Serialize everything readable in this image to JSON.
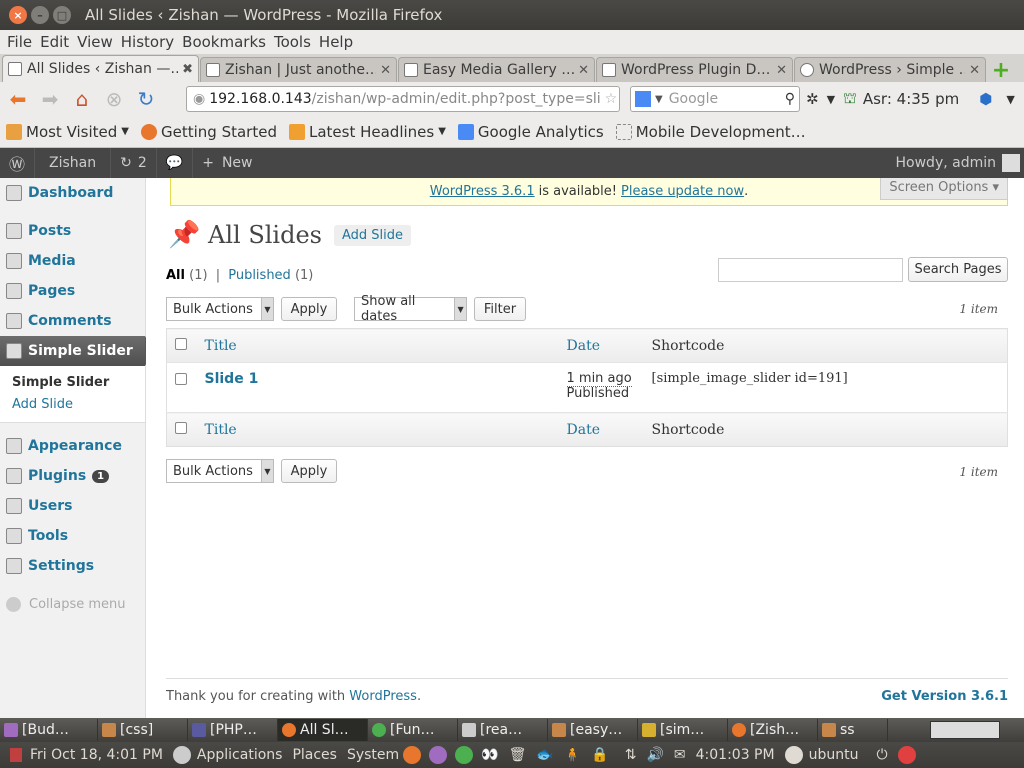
{
  "window": {
    "title": "All Slides ‹ Zishan — WordPress - Mozilla Firefox"
  },
  "menubar": [
    "File",
    "Edit",
    "View",
    "History",
    "Bookmarks",
    "Tools",
    "Help"
  ],
  "tabs": [
    {
      "label": "All Slides ‹ Zishan —…",
      "active": true
    },
    {
      "label": "Zishan | Just anothe…",
      "active": false
    },
    {
      "label": "Easy Media Gallery …",
      "active": false
    },
    {
      "label": "WordPress Plugin D…",
      "active": false
    },
    {
      "label": "WordPress › Simple …",
      "active": false
    }
  ],
  "nav": {
    "url_host": "192.168.0.143",
    "url_path": "/zishan/wp-admin/edit.php?post_type=sli",
    "search_placeholder": "Google",
    "extra": "Asr: 4:35 pm"
  },
  "bookmarks": [
    "Most Visited",
    "Getting Started",
    "Latest Headlines",
    "Google Analytics",
    "Mobile Development…"
  ],
  "adminbar": {
    "site": "Zishan",
    "updates": "2",
    "new": "New",
    "howdy": "Howdy, admin"
  },
  "sidebar": {
    "items": [
      {
        "label": "Dashboard"
      },
      {
        "label": "Posts"
      },
      {
        "label": "Media"
      },
      {
        "label": "Pages"
      },
      {
        "label": "Comments"
      },
      {
        "label": "Simple Slider"
      },
      {
        "label": "Appearance"
      },
      {
        "label": "Plugins"
      },
      {
        "label": "Users"
      },
      {
        "label": "Tools"
      },
      {
        "label": "Settings"
      }
    ],
    "submenu": [
      "Simple Slider",
      "Add Slide"
    ],
    "plugins_badge": "1",
    "collapse": "Collapse menu"
  },
  "notice": {
    "version_link": "WordPress 3.6.1",
    "text": "is available!",
    "update_link": "Please update now",
    "period": "."
  },
  "screen_options": "Screen Options ▾",
  "page": {
    "title": "All Slides",
    "add_new": "Add Slide",
    "filter_all": "All",
    "filter_all_count": "(1)",
    "filter_sep": "|",
    "filter_published": "Published",
    "filter_published_count": "(1)",
    "search_button": "Search Pages",
    "bulk_actions": "Bulk Actions",
    "apply": "Apply",
    "dates": "Show all dates",
    "filter": "Filter",
    "item_count": "1 item"
  },
  "table": {
    "headers": {
      "title": "Title",
      "date": "Date",
      "shortcode": "Shortcode"
    },
    "rows": [
      {
        "title": "Slide 1",
        "date": "1 min ago",
        "status": "Published",
        "shortcode": "[simple_image_slider id=191]"
      }
    ]
  },
  "footer": {
    "thanks": "Thank you for creating with",
    "wp_link": "WordPress",
    "period": ".",
    "version": "Get Version 3.6.1"
  },
  "taskbar": [
    "[Bud…",
    "[css]",
    "[PHP…",
    "All Sl…",
    "[Fun…",
    "[rea…",
    "[easy…",
    "[sim…",
    "[Zish…",
    "ss"
  ],
  "panel": {
    "date": "Fri Oct 18,  4:01 PM",
    "applications": "Applications",
    "places": "Places",
    "system": "System",
    "time": "4:01:03 PM",
    "user": "ubuntu"
  }
}
